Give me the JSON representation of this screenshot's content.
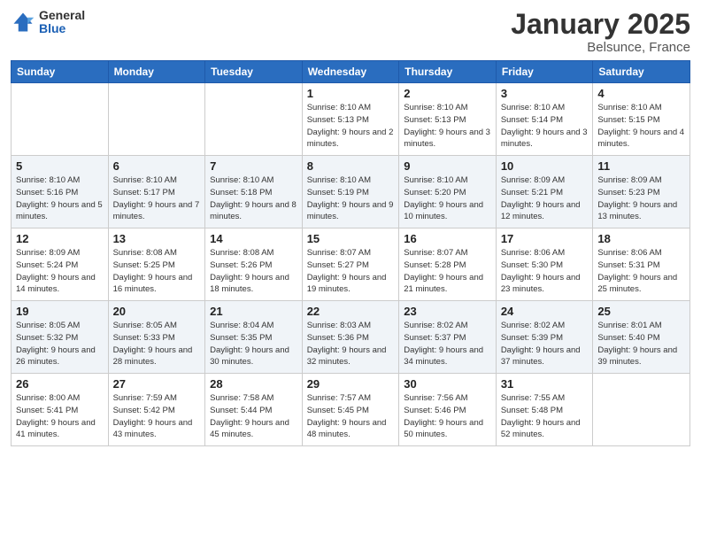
{
  "logo": {
    "general": "General",
    "blue": "Blue"
  },
  "title": "January 2025",
  "location": "Belsunce, France",
  "weekdays": [
    "Sunday",
    "Monday",
    "Tuesday",
    "Wednesday",
    "Thursday",
    "Friday",
    "Saturday"
  ],
  "weeks": [
    [
      {
        "day": "",
        "sunrise": "",
        "sunset": "",
        "daylight": ""
      },
      {
        "day": "",
        "sunrise": "",
        "sunset": "",
        "daylight": ""
      },
      {
        "day": "",
        "sunrise": "",
        "sunset": "",
        "daylight": ""
      },
      {
        "day": "1",
        "sunrise": "Sunrise: 8:10 AM",
        "sunset": "Sunset: 5:13 PM",
        "daylight": "Daylight: 9 hours and 2 minutes."
      },
      {
        "day": "2",
        "sunrise": "Sunrise: 8:10 AM",
        "sunset": "Sunset: 5:13 PM",
        "daylight": "Daylight: 9 hours and 3 minutes."
      },
      {
        "day": "3",
        "sunrise": "Sunrise: 8:10 AM",
        "sunset": "Sunset: 5:14 PM",
        "daylight": "Daylight: 9 hours and 3 minutes."
      },
      {
        "day": "4",
        "sunrise": "Sunrise: 8:10 AM",
        "sunset": "Sunset: 5:15 PM",
        "daylight": "Daylight: 9 hours and 4 minutes."
      }
    ],
    [
      {
        "day": "5",
        "sunrise": "Sunrise: 8:10 AM",
        "sunset": "Sunset: 5:16 PM",
        "daylight": "Daylight: 9 hours and 5 minutes."
      },
      {
        "day": "6",
        "sunrise": "Sunrise: 8:10 AM",
        "sunset": "Sunset: 5:17 PM",
        "daylight": "Daylight: 9 hours and 7 minutes."
      },
      {
        "day": "7",
        "sunrise": "Sunrise: 8:10 AM",
        "sunset": "Sunset: 5:18 PM",
        "daylight": "Daylight: 9 hours and 8 minutes."
      },
      {
        "day": "8",
        "sunrise": "Sunrise: 8:10 AM",
        "sunset": "Sunset: 5:19 PM",
        "daylight": "Daylight: 9 hours and 9 minutes."
      },
      {
        "day": "9",
        "sunrise": "Sunrise: 8:10 AM",
        "sunset": "Sunset: 5:20 PM",
        "daylight": "Daylight: 9 hours and 10 minutes."
      },
      {
        "day": "10",
        "sunrise": "Sunrise: 8:09 AM",
        "sunset": "Sunset: 5:21 PM",
        "daylight": "Daylight: 9 hours and 12 minutes."
      },
      {
        "day": "11",
        "sunrise": "Sunrise: 8:09 AM",
        "sunset": "Sunset: 5:23 PM",
        "daylight": "Daylight: 9 hours and 13 minutes."
      }
    ],
    [
      {
        "day": "12",
        "sunrise": "Sunrise: 8:09 AM",
        "sunset": "Sunset: 5:24 PM",
        "daylight": "Daylight: 9 hours and 14 minutes."
      },
      {
        "day": "13",
        "sunrise": "Sunrise: 8:08 AM",
        "sunset": "Sunset: 5:25 PM",
        "daylight": "Daylight: 9 hours and 16 minutes."
      },
      {
        "day": "14",
        "sunrise": "Sunrise: 8:08 AM",
        "sunset": "Sunset: 5:26 PM",
        "daylight": "Daylight: 9 hours and 18 minutes."
      },
      {
        "day": "15",
        "sunrise": "Sunrise: 8:07 AM",
        "sunset": "Sunset: 5:27 PM",
        "daylight": "Daylight: 9 hours and 19 minutes."
      },
      {
        "day": "16",
        "sunrise": "Sunrise: 8:07 AM",
        "sunset": "Sunset: 5:28 PM",
        "daylight": "Daylight: 9 hours and 21 minutes."
      },
      {
        "day": "17",
        "sunrise": "Sunrise: 8:06 AM",
        "sunset": "Sunset: 5:30 PM",
        "daylight": "Daylight: 9 hours and 23 minutes."
      },
      {
        "day": "18",
        "sunrise": "Sunrise: 8:06 AM",
        "sunset": "Sunset: 5:31 PM",
        "daylight": "Daylight: 9 hours and 25 minutes."
      }
    ],
    [
      {
        "day": "19",
        "sunrise": "Sunrise: 8:05 AM",
        "sunset": "Sunset: 5:32 PM",
        "daylight": "Daylight: 9 hours and 26 minutes."
      },
      {
        "day": "20",
        "sunrise": "Sunrise: 8:05 AM",
        "sunset": "Sunset: 5:33 PM",
        "daylight": "Daylight: 9 hours and 28 minutes."
      },
      {
        "day": "21",
        "sunrise": "Sunrise: 8:04 AM",
        "sunset": "Sunset: 5:35 PM",
        "daylight": "Daylight: 9 hours and 30 minutes."
      },
      {
        "day": "22",
        "sunrise": "Sunrise: 8:03 AM",
        "sunset": "Sunset: 5:36 PM",
        "daylight": "Daylight: 9 hours and 32 minutes."
      },
      {
        "day": "23",
        "sunrise": "Sunrise: 8:02 AM",
        "sunset": "Sunset: 5:37 PM",
        "daylight": "Daylight: 9 hours and 34 minutes."
      },
      {
        "day": "24",
        "sunrise": "Sunrise: 8:02 AM",
        "sunset": "Sunset: 5:39 PM",
        "daylight": "Daylight: 9 hours and 37 minutes."
      },
      {
        "day": "25",
        "sunrise": "Sunrise: 8:01 AM",
        "sunset": "Sunset: 5:40 PM",
        "daylight": "Daylight: 9 hours and 39 minutes."
      }
    ],
    [
      {
        "day": "26",
        "sunrise": "Sunrise: 8:00 AM",
        "sunset": "Sunset: 5:41 PM",
        "daylight": "Daylight: 9 hours and 41 minutes."
      },
      {
        "day": "27",
        "sunrise": "Sunrise: 7:59 AM",
        "sunset": "Sunset: 5:42 PM",
        "daylight": "Daylight: 9 hours and 43 minutes."
      },
      {
        "day": "28",
        "sunrise": "Sunrise: 7:58 AM",
        "sunset": "Sunset: 5:44 PM",
        "daylight": "Daylight: 9 hours and 45 minutes."
      },
      {
        "day": "29",
        "sunrise": "Sunrise: 7:57 AM",
        "sunset": "Sunset: 5:45 PM",
        "daylight": "Daylight: 9 hours and 48 minutes."
      },
      {
        "day": "30",
        "sunrise": "Sunrise: 7:56 AM",
        "sunset": "Sunset: 5:46 PM",
        "daylight": "Daylight: 9 hours and 50 minutes."
      },
      {
        "day": "31",
        "sunrise": "Sunrise: 7:55 AM",
        "sunset": "Sunset: 5:48 PM",
        "daylight": "Daylight: 9 hours and 52 minutes."
      },
      {
        "day": "",
        "sunrise": "",
        "sunset": "",
        "daylight": ""
      }
    ]
  ]
}
